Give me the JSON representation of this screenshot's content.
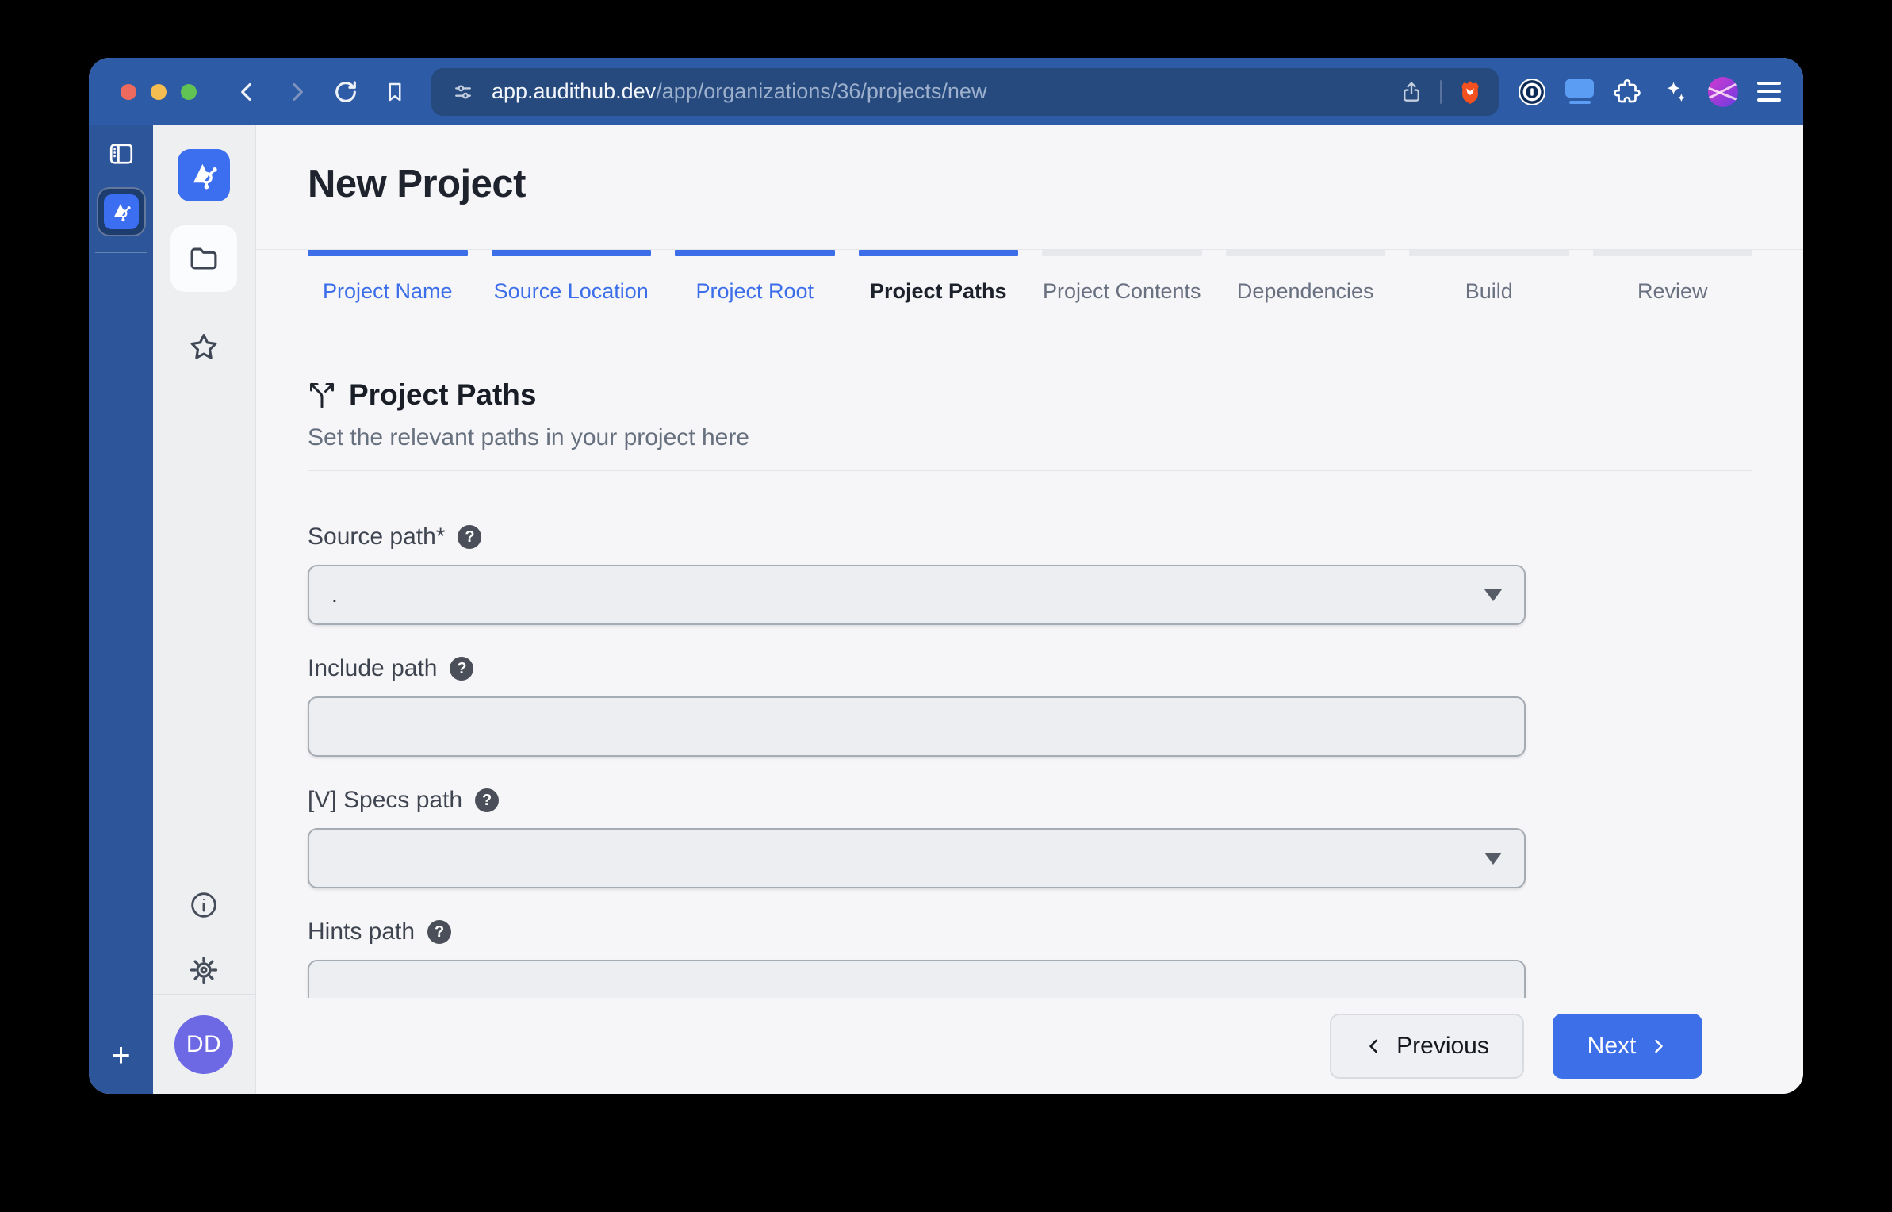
{
  "browser": {
    "url_host": "app.audithub.dev",
    "url_path": "/app/organizations/36/projects/new",
    "new_tab_label": "+"
  },
  "app_sidebar": {
    "avatar_initials": "DD"
  },
  "page": {
    "title": "New Project"
  },
  "steps": [
    {
      "label": "Project Name",
      "state": "done"
    },
    {
      "label": "Source Location",
      "state": "done"
    },
    {
      "label": "Project Root",
      "state": "done"
    },
    {
      "label": "Project Paths",
      "state": "active"
    },
    {
      "label": "Project Contents",
      "state": "upcoming"
    },
    {
      "label": "Dependencies",
      "state": "upcoming"
    },
    {
      "label": "Build",
      "state": "upcoming"
    },
    {
      "label": "Review",
      "state": "upcoming"
    }
  ],
  "section": {
    "title": "Project Paths",
    "subtitle": "Set the relevant paths in your project here",
    "help_glyph": "?"
  },
  "fields": [
    {
      "label": "Source path*",
      "type": "select",
      "value": "."
    },
    {
      "label": "Include path",
      "type": "text",
      "value": ""
    },
    {
      "label": "[V] Specs path",
      "type": "select",
      "value": ""
    },
    {
      "label": "Hints path",
      "type": "text",
      "value": ""
    }
  ],
  "footer": {
    "previous_label": "Previous",
    "next_label": "Next"
  },
  "colors": {
    "accent_blue": "#3b6ee8",
    "toolbar_blue": "#2e5ba6",
    "urlbar_blue": "#26497e",
    "sidebar_blue": "#2d5599",
    "avatar_purple": "#6d68e4",
    "brave_orange": "#f4511f"
  }
}
